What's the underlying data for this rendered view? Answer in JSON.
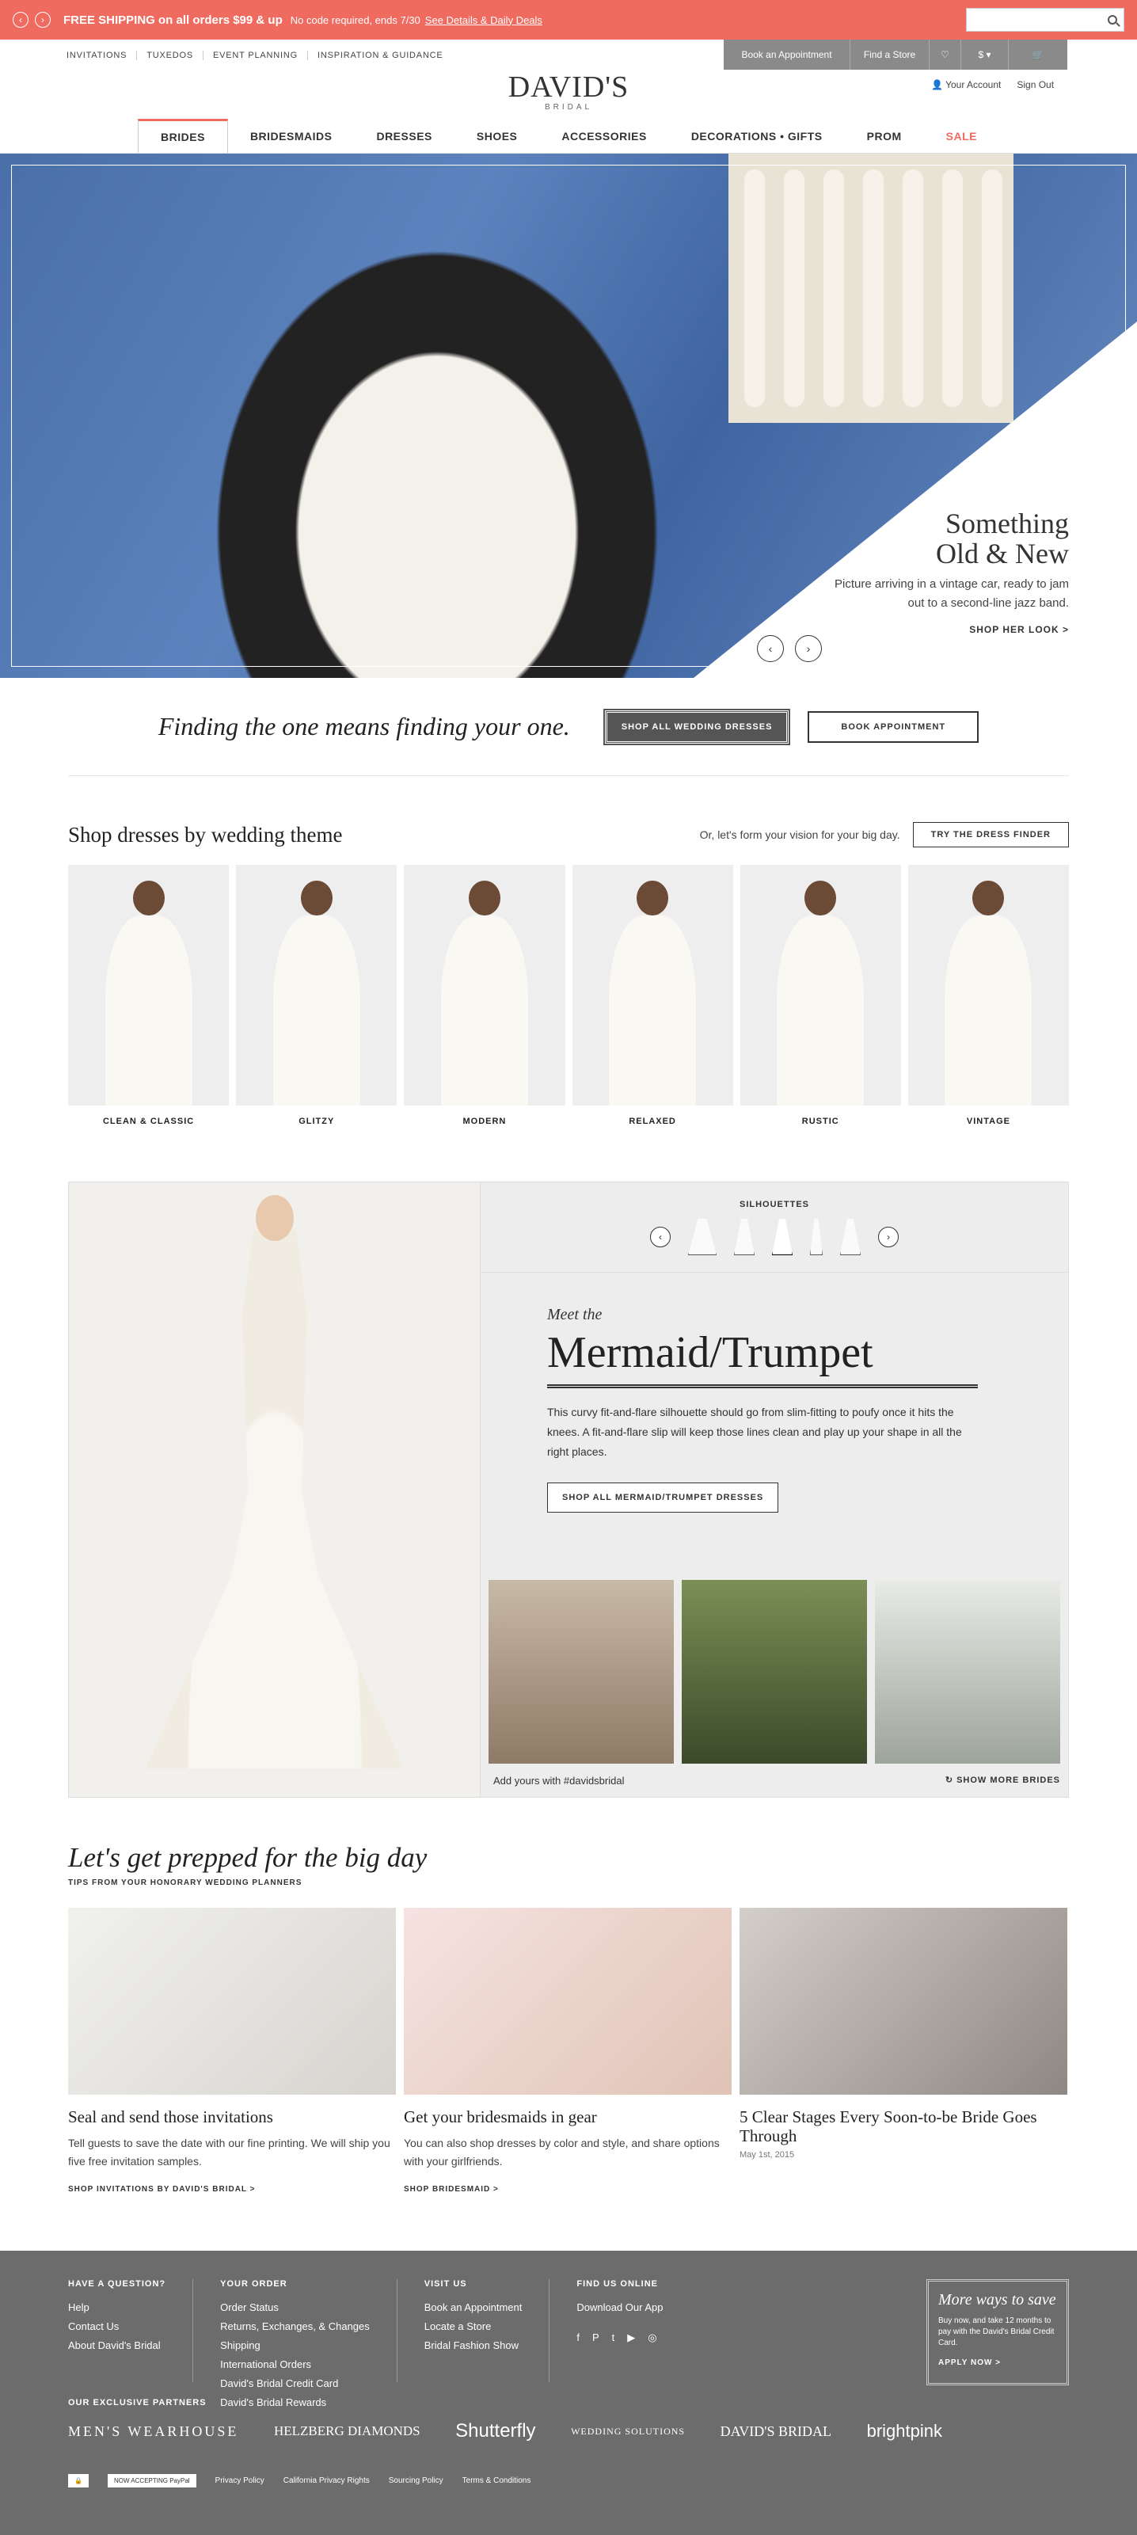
{
  "promo": {
    "bold": "FREE SHIPPING on all orders $99 & up",
    "sub": "No code required, ends 7/30",
    "link": "See Details & Daily Deals"
  },
  "topnav": [
    "INVITATIONS",
    "TUXEDOS",
    "EVENT PLANNING",
    "INSPIRATION & GUIDANCE"
  ],
  "tools": {
    "appointment": "Book an Appointment",
    "store": "Find a Store",
    "currency": "$"
  },
  "logo": {
    "name": "DAVID'S",
    "sub": "BRIDAL"
  },
  "account": {
    "your_account": "Your Account",
    "sign_out": "Sign Out"
  },
  "mainnav": [
    "BRIDES",
    "BRIDESMAIDS",
    "DRESSES",
    "SHOES",
    "ACCESSORIES",
    "DECORATIONS • GIFTS",
    "PROM",
    "SALE"
  ],
  "hero": {
    "title1": "Something",
    "title2": "Old & New",
    "desc": "Picture arriving in a vintage car, ready to jam out to a second-line jazz band.",
    "cta": "SHOP HER LOOK >"
  },
  "finding": {
    "tagline": "Finding the one means finding your one.",
    "btn1": "SHOP ALL WEDDING DRESSES",
    "btn2": "BOOK APPOINTMENT"
  },
  "theme": {
    "title": "Shop dresses by wedding theme",
    "or": "Or, let's form your vision for your big day.",
    "btn": "TRY THE DRESS FINDER",
    "items": [
      "CLEAN & CLASSIC",
      "GLITZY",
      "MODERN",
      "RELAXED",
      "RUSTIC",
      "VINTAGE"
    ]
  },
  "silhouette": {
    "label": "SILHOUETTES",
    "meet": "Meet the",
    "title": "Mermaid/Trumpet",
    "desc": "This curvy fit-and-flare silhouette should go from slim-fitting to poufy once it hits the knees. A fit-and-flare slip will keep those lines clean and play up your shape in all the right places.",
    "shop": "SHOP ALL MERMAID/TRUMPET DRESSES",
    "hashtag": "Add yours with #davidsbridal",
    "more": "SHOW MORE BRIDES"
  },
  "prep": {
    "title": "Let's get prepped for the big day",
    "tips": "TIPS FROM YOUR HONORARY WEDDING PLANNERS",
    "cards": [
      {
        "title": "Seal and send those invitations",
        "desc": "Tell guests to save the date with our fine printing. We will ship you five free invitation samples.",
        "link": "SHOP INVITATIONS BY DAVID'S BRIDAL >"
      },
      {
        "title": "Get your bridesmaids in gear",
        "desc": "You can also shop dresses by color and style, and share options with your girlfriends.",
        "link": "SHOP BRIDESMAID >"
      },
      {
        "title": "5 Clear Stages Every Soon-to-be Bride Goes Through",
        "date": "May 1st, 2015"
      }
    ]
  },
  "footer": {
    "question": {
      "h": "HAVE A QUESTION?",
      "items": [
        "Help",
        "Contact Us",
        "About David's Bridal"
      ]
    },
    "order": {
      "h": "YOUR ORDER",
      "col1": [
        "Order Status",
        "Returns, Exchanges, & Changes",
        "Shipping"
      ],
      "col2": [
        "International Orders",
        "David's Bridal Credit Card",
        "David's Bridal Rewards"
      ]
    },
    "visit": {
      "h": "VISIT US",
      "items": [
        "Book an Appointment",
        "Locate a Store",
        "Bridal Fashion Show"
      ]
    },
    "online": {
      "h": "FIND US ONLINE",
      "items": [
        "Download Our App"
      ]
    },
    "save": {
      "h": "More ways to save",
      "p": "Buy now, and take 12 months to pay with the David's Bridal Credit Card.",
      "a": "APPLY NOW >"
    },
    "partners_h": "OUR EXCLUSIVE PARTNERS",
    "partners": [
      "MEN'S WEARHOUSE",
      "HELZBERG DIAMONDS",
      "Shutterfly",
      "WEDDING SOLUTIONS",
      "DAVID'S BRIDAL",
      "brightpink"
    ],
    "legal": [
      "Privacy Policy",
      "California Privacy Rights",
      "Sourcing Policy",
      "Terms & Conditions"
    ],
    "paypal": "NOW ACCEPTING PayPal"
  }
}
